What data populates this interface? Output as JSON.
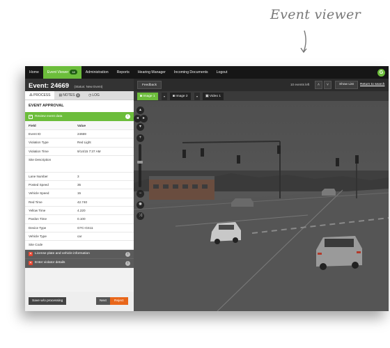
{
  "caption": "Event viewer",
  "nav": {
    "items": [
      "Home",
      "Event Viewer",
      "Administration",
      "Reports",
      "Hearing Manager",
      "Incoming Documents",
      "Logout"
    ],
    "event_viewer_badge": "18",
    "logo_letter": "G"
  },
  "event": {
    "title": "Event: 24669",
    "status": "(Status: New Event)"
  },
  "tabs": {
    "process": "PROCESS",
    "notes": "NOTES",
    "notes_count": "0",
    "log": "LOG"
  },
  "approval": {
    "section_title": "EVENT APPROVAL",
    "step1": "Review event data",
    "col_field": "Field",
    "col_value": "Value",
    "rows": [
      {
        "field": "Event ID",
        "value": "24669"
      },
      {
        "field": "Violation Type",
        "value": "Red Light"
      },
      {
        "field": "Violation Time",
        "value": "9/14/15 7:37 AM"
      },
      {
        "field": "Site Description",
        "value": ""
      },
      {
        "field": "Lane Number",
        "value": "3"
      },
      {
        "field": "Posted Speed",
        "value": "35"
      },
      {
        "field": "Vehicle Speed",
        "value": "15"
      },
      {
        "field": "Red Time",
        "value": "42.740"
      },
      {
        "field": "Yellow Time",
        "value": "4.220"
      },
      {
        "field": "Pardon Time",
        "value": "0.100"
      },
      {
        "field": "Device Type",
        "value": "GTC-GS11"
      },
      {
        "field": "Vehicle Type",
        "value": "car"
      },
      {
        "field": "Site Code",
        "value": ""
      }
    ],
    "step2": "License plate and vehicle information",
    "step3": "Enter violator details"
  },
  "actions": {
    "save": "Save w/o processing",
    "next": "Next",
    "reject": "Reject"
  },
  "viewer": {
    "feedback": "Feedback",
    "events_left": "10 events left",
    "show_list": "Show List",
    "return_to_search": "Return to search",
    "media": [
      "Image 1",
      "Image 2",
      "Video 1"
    ]
  },
  "colors": {
    "accent": "#6cbd3b",
    "reject": "#e8661a",
    "nav_bg": "#161616"
  }
}
